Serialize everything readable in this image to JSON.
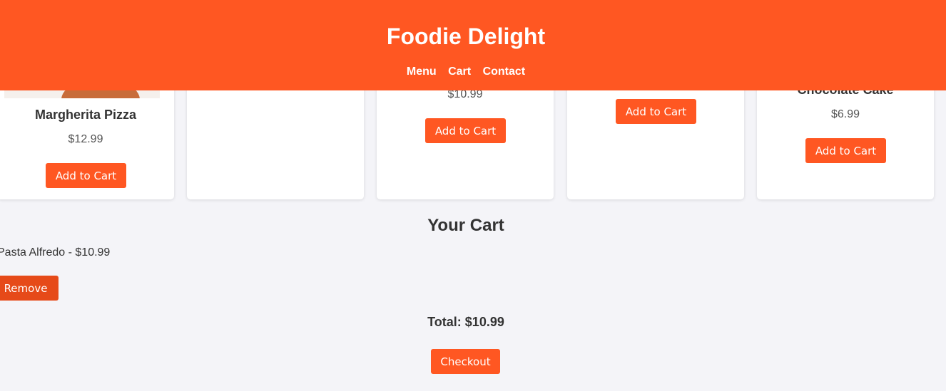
{
  "header": {
    "title": "Foodie Delight",
    "nav": [
      "Menu",
      "Cart",
      "Contact"
    ]
  },
  "menu": {
    "items": [
      {
        "name": "Margherita Pizza",
        "price": "$12.99",
        "button": "Add to Cart"
      },
      {
        "name": "",
        "price": "",
        "button": ""
      },
      {
        "name": "",
        "price": "$10.99",
        "button": "Add to Cart"
      },
      {
        "name": "",
        "price": "",
        "button": "Add to Cart"
      },
      {
        "name": "Chocolate Cake",
        "price": "$6.99",
        "button": "Add to Cart"
      }
    ]
  },
  "cart": {
    "heading": "Your Cart",
    "items": [
      {
        "label": "Pasta Alfredo - $10.99",
        "remove_label": "Remove"
      }
    ],
    "total": "Total: $10.99",
    "checkout_label": "Checkout"
  },
  "colors": {
    "accent": "#ff5722",
    "remove": "#e64a19",
    "background": "#f4f4f8"
  }
}
